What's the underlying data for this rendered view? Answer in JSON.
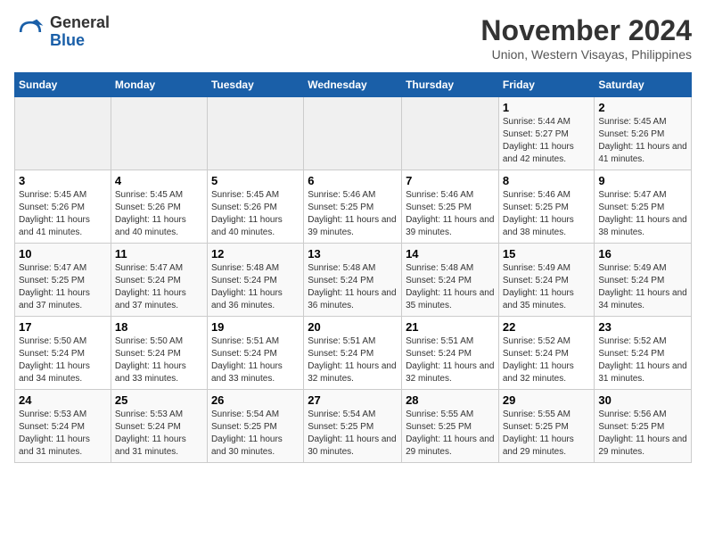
{
  "header": {
    "logo_line1": "General",
    "logo_line2": "Blue",
    "month_year": "November 2024",
    "location": "Union, Western Visayas, Philippines"
  },
  "weekdays": [
    "Sunday",
    "Monday",
    "Tuesday",
    "Wednesday",
    "Thursday",
    "Friday",
    "Saturday"
  ],
  "weeks": [
    [
      {
        "day": "",
        "info": ""
      },
      {
        "day": "",
        "info": ""
      },
      {
        "day": "",
        "info": ""
      },
      {
        "day": "",
        "info": ""
      },
      {
        "day": "",
        "info": ""
      },
      {
        "day": "1",
        "info": "Sunrise: 5:44 AM\nSunset: 5:27 PM\nDaylight: 11 hours and 42 minutes."
      },
      {
        "day": "2",
        "info": "Sunrise: 5:45 AM\nSunset: 5:26 PM\nDaylight: 11 hours and 41 minutes."
      }
    ],
    [
      {
        "day": "3",
        "info": "Sunrise: 5:45 AM\nSunset: 5:26 PM\nDaylight: 11 hours and 41 minutes."
      },
      {
        "day": "4",
        "info": "Sunrise: 5:45 AM\nSunset: 5:26 PM\nDaylight: 11 hours and 40 minutes."
      },
      {
        "day": "5",
        "info": "Sunrise: 5:45 AM\nSunset: 5:26 PM\nDaylight: 11 hours and 40 minutes."
      },
      {
        "day": "6",
        "info": "Sunrise: 5:46 AM\nSunset: 5:25 PM\nDaylight: 11 hours and 39 minutes."
      },
      {
        "day": "7",
        "info": "Sunrise: 5:46 AM\nSunset: 5:25 PM\nDaylight: 11 hours and 39 minutes."
      },
      {
        "day": "8",
        "info": "Sunrise: 5:46 AM\nSunset: 5:25 PM\nDaylight: 11 hours and 38 minutes."
      },
      {
        "day": "9",
        "info": "Sunrise: 5:47 AM\nSunset: 5:25 PM\nDaylight: 11 hours and 38 minutes."
      }
    ],
    [
      {
        "day": "10",
        "info": "Sunrise: 5:47 AM\nSunset: 5:25 PM\nDaylight: 11 hours and 37 minutes."
      },
      {
        "day": "11",
        "info": "Sunrise: 5:47 AM\nSunset: 5:24 PM\nDaylight: 11 hours and 37 minutes."
      },
      {
        "day": "12",
        "info": "Sunrise: 5:48 AM\nSunset: 5:24 PM\nDaylight: 11 hours and 36 minutes."
      },
      {
        "day": "13",
        "info": "Sunrise: 5:48 AM\nSunset: 5:24 PM\nDaylight: 11 hours and 36 minutes."
      },
      {
        "day": "14",
        "info": "Sunrise: 5:48 AM\nSunset: 5:24 PM\nDaylight: 11 hours and 35 minutes."
      },
      {
        "day": "15",
        "info": "Sunrise: 5:49 AM\nSunset: 5:24 PM\nDaylight: 11 hours and 35 minutes."
      },
      {
        "day": "16",
        "info": "Sunrise: 5:49 AM\nSunset: 5:24 PM\nDaylight: 11 hours and 34 minutes."
      }
    ],
    [
      {
        "day": "17",
        "info": "Sunrise: 5:50 AM\nSunset: 5:24 PM\nDaylight: 11 hours and 34 minutes."
      },
      {
        "day": "18",
        "info": "Sunrise: 5:50 AM\nSunset: 5:24 PM\nDaylight: 11 hours and 33 minutes."
      },
      {
        "day": "19",
        "info": "Sunrise: 5:51 AM\nSunset: 5:24 PM\nDaylight: 11 hours and 33 minutes."
      },
      {
        "day": "20",
        "info": "Sunrise: 5:51 AM\nSunset: 5:24 PM\nDaylight: 11 hours and 32 minutes."
      },
      {
        "day": "21",
        "info": "Sunrise: 5:51 AM\nSunset: 5:24 PM\nDaylight: 11 hours and 32 minutes."
      },
      {
        "day": "22",
        "info": "Sunrise: 5:52 AM\nSunset: 5:24 PM\nDaylight: 11 hours and 32 minutes."
      },
      {
        "day": "23",
        "info": "Sunrise: 5:52 AM\nSunset: 5:24 PM\nDaylight: 11 hours and 31 minutes."
      }
    ],
    [
      {
        "day": "24",
        "info": "Sunrise: 5:53 AM\nSunset: 5:24 PM\nDaylight: 11 hours and 31 minutes."
      },
      {
        "day": "25",
        "info": "Sunrise: 5:53 AM\nSunset: 5:24 PM\nDaylight: 11 hours and 31 minutes."
      },
      {
        "day": "26",
        "info": "Sunrise: 5:54 AM\nSunset: 5:25 PM\nDaylight: 11 hours and 30 minutes."
      },
      {
        "day": "27",
        "info": "Sunrise: 5:54 AM\nSunset: 5:25 PM\nDaylight: 11 hours and 30 minutes."
      },
      {
        "day": "28",
        "info": "Sunrise: 5:55 AM\nSunset: 5:25 PM\nDaylight: 11 hours and 29 minutes."
      },
      {
        "day": "29",
        "info": "Sunrise: 5:55 AM\nSunset: 5:25 PM\nDaylight: 11 hours and 29 minutes."
      },
      {
        "day": "30",
        "info": "Sunrise: 5:56 AM\nSunset: 5:25 PM\nDaylight: 11 hours and 29 minutes."
      }
    ]
  ]
}
